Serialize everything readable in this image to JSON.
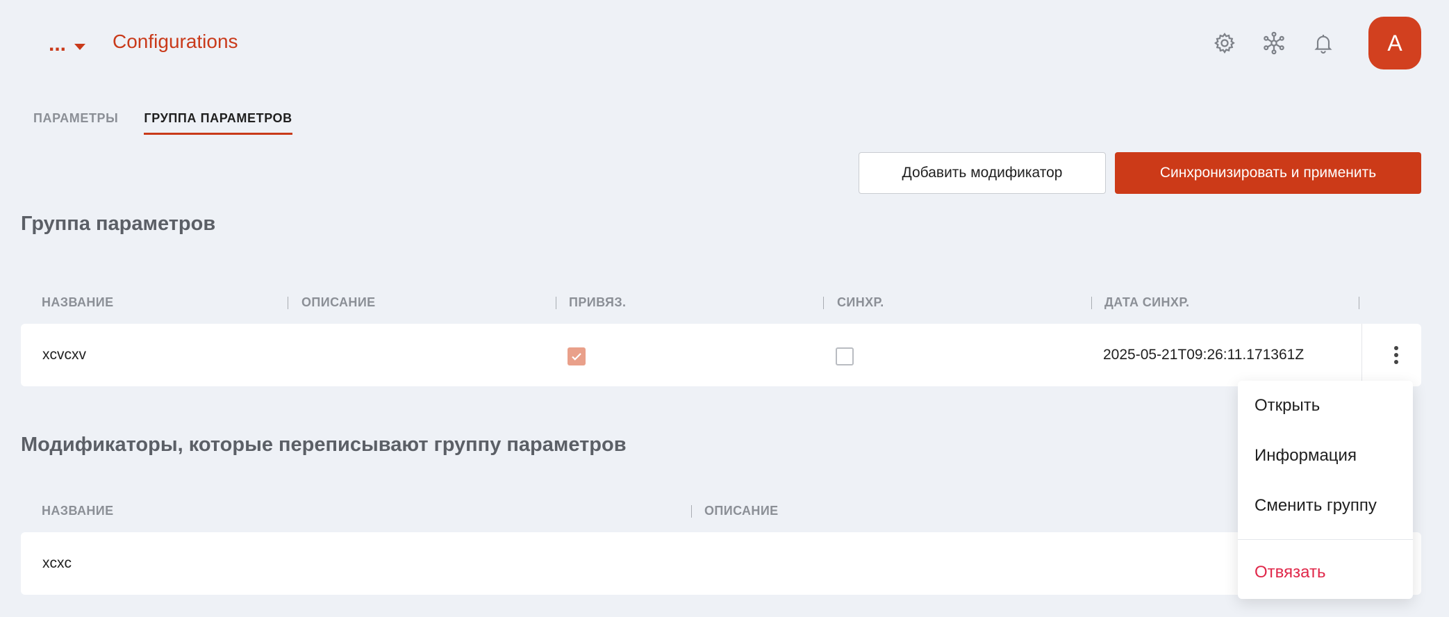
{
  "header": {
    "more_label": "...",
    "app_title": "Configurations",
    "avatar_initial": "A"
  },
  "tabs": [
    {
      "label": "ПАРАМЕТРЫ",
      "active": false
    },
    {
      "label": "ГРУППА ПАРАМЕТРОВ",
      "active": true
    }
  ],
  "actions": {
    "add_modifier": "Добавить модификатор",
    "sync_apply": "Синхронизировать и применить"
  },
  "group_section": {
    "title": "Группа параметров",
    "columns": [
      "НАЗВАНИЕ",
      "ОПИСАНИЕ",
      "ПРИВЯЗ.",
      "СИНХР.",
      "ДАТА СИНХР."
    ],
    "rows": [
      {
        "name": "xcvcxv",
        "description": "",
        "bound": true,
        "synced": false,
        "sync_date": "2025-05-21T09:26:11.171361Z"
      }
    ]
  },
  "modifiers_section": {
    "title": "Модификаторы, которые переписывают группу параметров",
    "columns": [
      "НАЗВАНИЕ",
      "ОПИСАНИЕ"
    ],
    "rows": [
      {
        "name": "xcxc",
        "description": ""
      }
    ]
  },
  "context_menu": {
    "items": [
      "Открыть",
      "Информация",
      "Сменить группу"
    ],
    "danger_item": "Отвязать"
  },
  "colors": {
    "accent": "#cc3a18",
    "background": "#eef1f6",
    "checked_fill": "#e9a08a",
    "danger_text": "#e0284a"
  }
}
